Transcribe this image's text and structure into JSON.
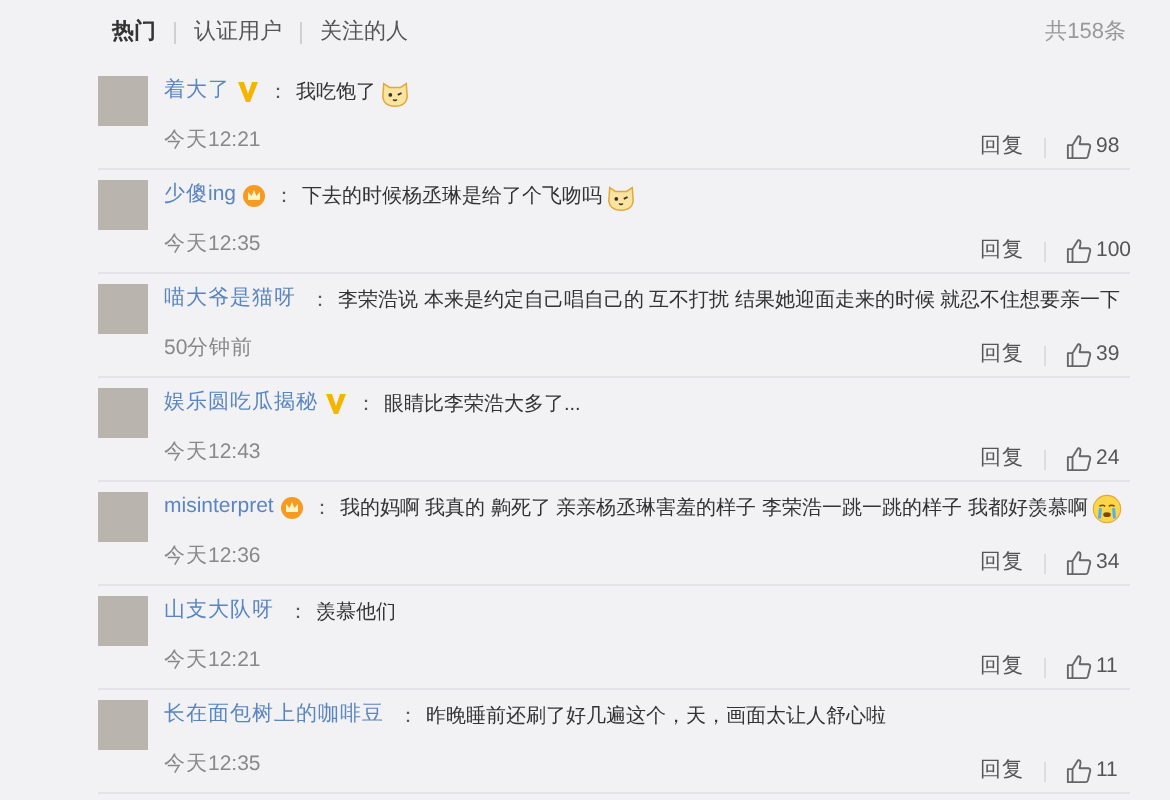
{
  "tabs": [
    {
      "label": "热门",
      "selected": true
    },
    {
      "label": "认证用户",
      "selected": false
    },
    {
      "label": "关注的人",
      "selected": false
    }
  ],
  "total": "共158条",
  "comments": [
    {
      "name": "着大了",
      "badge": {
        "kind": "vip"
      },
      "separator": "：",
      "text": "我吃饱了",
      "emoji": {
        "kind": "cat"
      },
      "time": "今天12:21",
      "reply": "回复",
      "likes": "98"
    },
    {
      "name": "少傻ing",
      "badge": {
        "kind": "member"
      },
      "separator": "：",
      "text": "下去的时候杨丞琳是给了个飞吻吗",
      "emoji": {
        "kind": "cat"
      },
      "time": "今天12:35",
      "reply": "回复",
      "likes": "100"
    },
    {
      "name": "喵大爷是猫呀",
      "separator": "：",
      "text": "李荣浩说 本来是约定自己唱自己的 互不打扰 结果她迎面走来的时候 就忍不住想要亲一下",
      "time": "50分钟前",
      "reply": "回复",
      "likes": "39"
    },
    {
      "name": "娱乐圆吃瓜揭秘",
      "badge": {
        "kind": "vip"
      },
      "separator": "：",
      "text": "眼睛比李荣浩大多了...",
      "time": "今天12:43",
      "reply": "回复",
      "likes": "24"
    },
    {
      "name": "misinterpret",
      "badge": {
        "kind": "member"
      },
      "separator": "：",
      "text": "我的妈啊 我真的 齁死了 亲亲杨丞琳害羞的样子 李荣浩一跳一跳的样子 我都好羡慕啊",
      "emoji": {
        "kind": "cry"
      },
      "time": "今天12:36",
      "reply": "回复",
      "likes": "34"
    },
    {
      "name": "山支大队呀",
      "separator": "：",
      "text": "羡慕他们",
      "time": "今天12:21",
      "reply": "回复",
      "likes": "11"
    },
    {
      "name": "长在面包树上的咖啡豆",
      "separator": "：",
      "text": "昨晚睡前还刷了好几遍这个，天，画面太让人舒心啦",
      "time": "今天12:35",
      "reply": "回复",
      "likes": "11"
    }
  ]
}
